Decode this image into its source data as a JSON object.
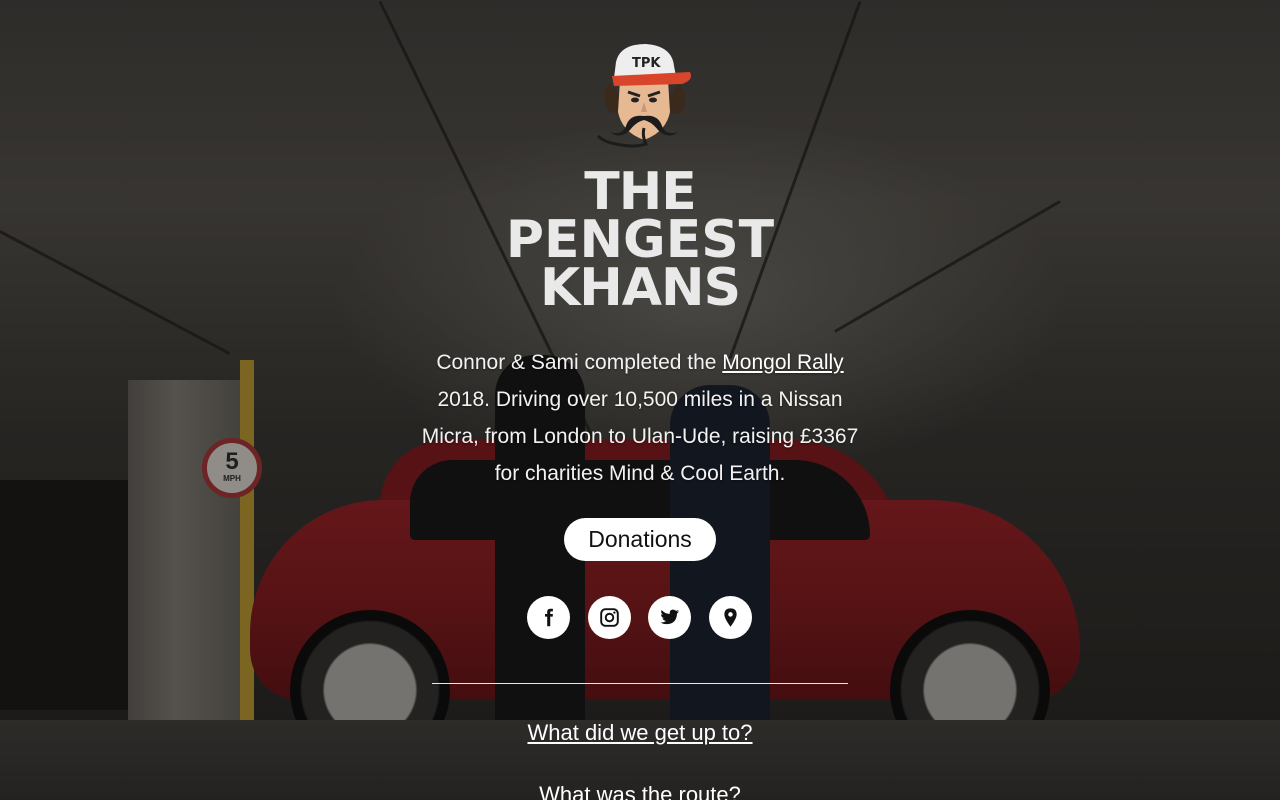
{
  "brand": {
    "logo_initials": "TPK",
    "wordmark_line1": "The",
    "wordmark_line2": "Pengest",
    "wordmark_line3": "Khans"
  },
  "intro": {
    "text_before_link": "Connor & Sami completed the ",
    "link_label": "Mongol Rally",
    "text_after_link": " 2018. Driving over 10,500 miles in a Nissan Micra, from London to Ulan-Ude, raising £3367 for charities Mind & Cool Earth."
  },
  "background": {
    "speed_sign_value": "5",
    "speed_sign_unit": "MPH"
  },
  "actions": {
    "donations_label": "Donations"
  },
  "social": {
    "icons": [
      "facebook-icon",
      "instagram-icon",
      "twitter-icon",
      "map-pin-icon"
    ]
  },
  "sections": {
    "what_label": "What did we get up to?",
    "route_label": "What was the route?"
  },
  "colors": {
    "button_bg": "#ffffff",
    "button_text": "#111111",
    "logo_cap": "#d9452b",
    "text": "#ffffff"
  }
}
